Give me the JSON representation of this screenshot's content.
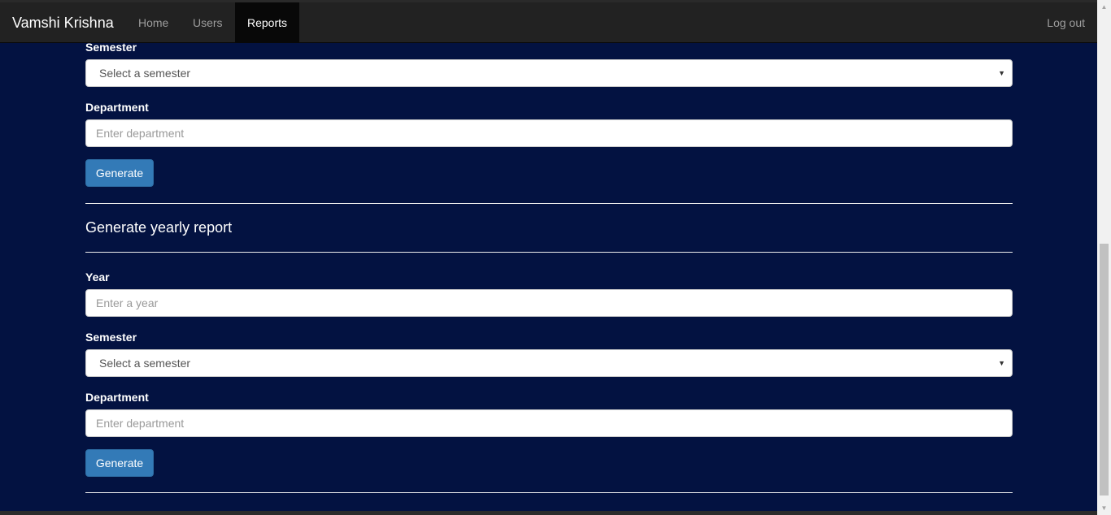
{
  "navbar": {
    "brand": "Vamshi Krishna",
    "items": [
      {
        "label": "Home"
      },
      {
        "label": "Users"
      },
      {
        "label": "Reports"
      }
    ],
    "logout": "Log out"
  },
  "semester_report_tail": {
    "semester_label": "Semester",
    "semester_select": "Select a semester",
    "department_label": "Department",
    "department_placeholder": "Enter department",
    "generate_label": "Generate"
  },
  "yearly_report": {
    "heading": "Generate yearly report",
    "year_label": "Year",
    "year_placeholder": "Enter a year",
    "semester_label": "Semester",
    "semester_select": "Select a semester",
    "department_label": "Department",
    "department_placeholder": "Enter department",
    "generate_label": "Generate"
  },
  "icons": {
    "caret": "chevron-down-icon",
    "scroll_up": "arrow-up-icon",
    "scroll_down": "arrow-down-icon"
  }
}
